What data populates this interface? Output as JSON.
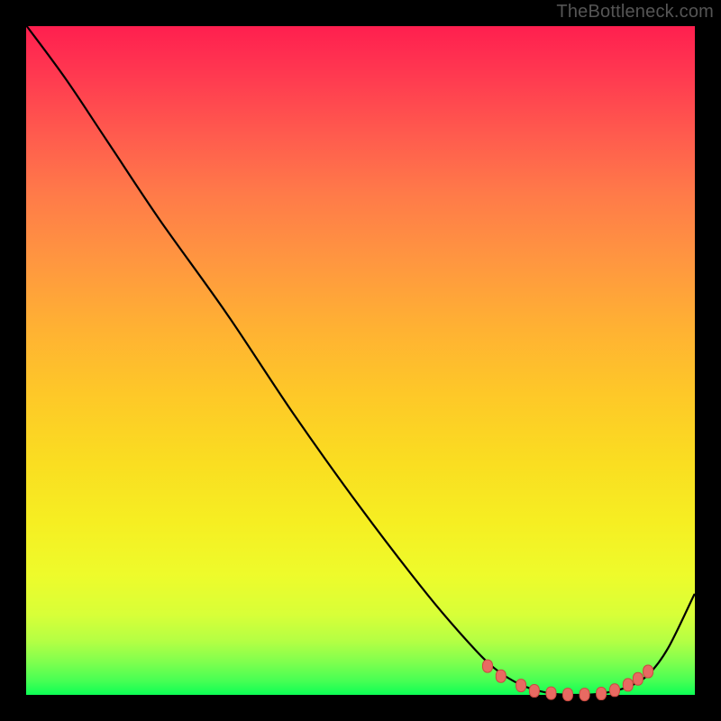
{
  "watermark": {
    "text": "TheBottleneck.com"
  },
  "chart_data": {
    "type": "line",
    "title": "",
    "xlabel": "",
    "ylabel": "",
    "xlim": [
      0,
      100
    ],
    "ylim": [
      0,
      100
    ],
    "grid": false,
    "legend": false,
    "annotations": [],
    "gradient_stops": [
      {
        "pct": 0,
        "color": "#ff1f4f"
      },
      {
        "pct": 7,
        "color": "#ff3850"
      },
      {
        "pct": 16,
        "color": "#ff5a4e"
      },
      {
        "pct": 25,
        "color": "#ff7a49"
      },
      {
        "pct": 35,
        "color": "#ff9640"
      },
      {
        "pct": 45,
        "color": "#ffb133"
      },
      {
        "pct": 55,
        "color": "#fec828"
      },
      {
        "pct": 65,
        "color": "#fadd21"
      },
      {
        "pct": 74,
        "color": "#f6ee22"
      },
      {
        "pct": 82,
        "color": "#eefb2b"
      },
      {
        "pct": 88,
        "color": "#d8ff38"
      },
      {
        "pct": 92,
        "color": "#b4ff44"
      },
      {
        "pct": 95,
        "color": "#81ff4e"
      },
      {
        "pct": 98,
        "color": "#45ff54"
      },
      {
        "pct": 100,
        "color": "#0dff55"
      }
    ],
    "series": [
      {
        "name": "bottleneck-curve",
        "x": [
          0.1,
          6,
          12,
          20,
          30,
          40,
          50,
          60,
          66,
          70,
          74,
          78,
          82,
          86,
          90,
          93,
          96,
          99.9
        ],
        "y": [
          100,
          92,
          83,
          71,
          57,
          42,
          28,
          15,
          8,
          4,
          1.5,
          0.3,
          0,
          0.2,
          1.2,
          3,
          7,
          15
        ]
      }
    ],
    "markers": {
      "name": "optimal-zone-dots",
      "points": [
        {
          "x": 69,
          "y": 4.3
        },
        {
          "x": 71,
          "y": 2.8
        },
        {
          "x": 74,
          "y": 1.4
        },
        {
          "x": 76,
          "y": 0.6
        },
        {
          "x": 78.5,
          "y": 0.25
        },
        {
          "x": 81,
          "y": 0.05
        },
        {
          "x": 83.5,
          "y": 0.05
        },
        {
          "x": 86,
          "y": 0.2
        },
        {
          "x": 88,
          "y": 0.7
        },
        {
          "x": 90,
          "y": 1.5
        },
        {
          "x": 91.5,
          "y": 2.4
        },
        {
          "x": 93,
          "y": 3.5
        }
      ]
    }
  }
}
